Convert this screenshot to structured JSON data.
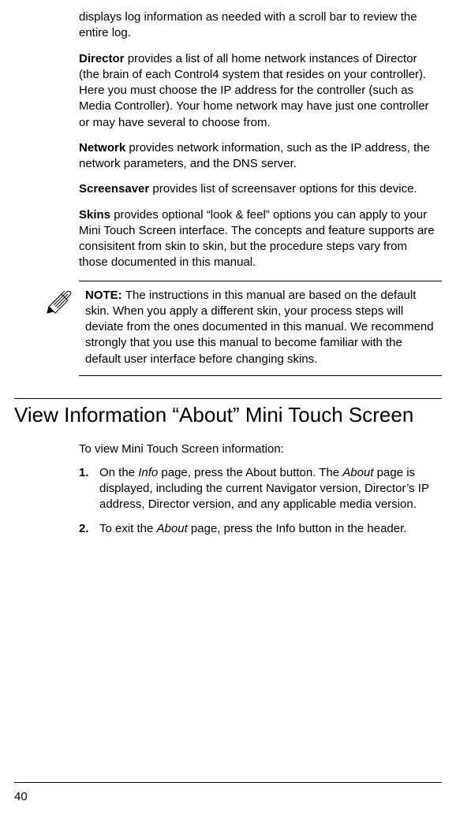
{
  "intro_tail": "displays log information as needed with a scroll bar to review the entire log.",
  "director": {
    "label": "Director",
    "text": " provides a list of all home network instances of Director (the brain of each Control4 system that resides on your controller). Here you must choose the IP address for the controller (such as Media Controller). Your home network may have just one controller or may have several to choose from."
  },
  "network": {
    "label": "Network",
    "text": " provides network information, such as the IP address, the network parameters, and the DNS server."
  },
  "screensaver": {
    "label": "Screensaver",
    "text": " provides list of screensaver options for this device."
  },
  "skins": {
    "label": "Skins",
    "text": " provides optional “look & feel” options you can apply to your Mini Touch Screen interface. The concepts and feature supports are consisitent from skin to skin, but the procedure steps vary from those documented in this manual."
  },
  "note": {
    "label": "NOTE:  ",
    "text": "The instructions in this manual are based on the default skin. When you apply a different skin, your process steps will deviate from the ones documented in this manual. We recommend strongly that you use this manual to become familiar with the default user interface before changing skins."
  },
  "section_title": "View Information “About” Mini Touch Screen",
  "lead": "To view Mini Touch Screen information:",
  "steps": [
    {
      "num": "1.",
      "pre": "On the ",
      "it1": "Info",
      "mid": " page, press the About button. The ",
      "it2": "About",
      "post": " page is displayed, including the current Navigator version, Director’s IP address, Director version, and any applicable media version."
    },
    {
      "num": "2.",
      "pre": "To exit the ",
      "it1": "About",
      "mid": " page, press the Info button in the header.",
      "it2": "",
      "post": ""
    }
  ],
  "page_number": "40"
}
